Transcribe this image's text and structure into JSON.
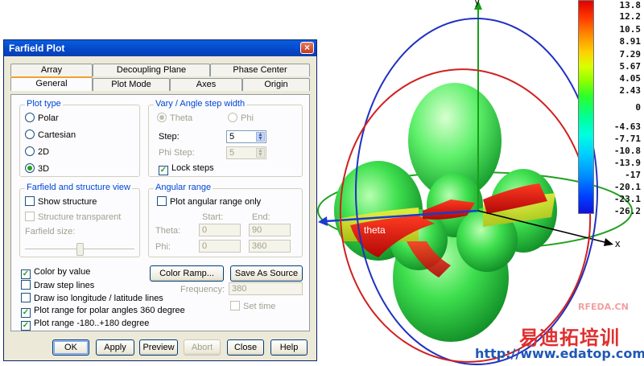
{
  "dialog": {
    "title": "Farfield Plot",
    "close_glyph": "×",
    "tabs_back": [
      "Array",
      "Decoupling Plane",
      "Phase Center"
    ],
    "tabs_front": [
      "General",
      "Plot Mode",
      "Axes",
      "Origin"
    ],
    "active_tab": "General",
    "plot_type": {
      "title": "Plot type",
      "options": [
        "Polar",
        "Cartesian",
        "2D",
        "3D"
      ],
      "selected": "3D"
    },
    "vary": {
      "title": "Vary / Angle step width",
      "theta_label": "Theta",
      "phi_label": "Phi",
      "step_label": "Step:",
      "step_value": "5",
      "phi_step_label": "Phi Step:",
      "phi_step_value": "5",
      "lock_steps_label": "Lock steps",
      "lock_steps_checked": true
    },
    "structure": {
      "title": "Farfield and structure view",
      "show_structure_label": "Show structure",
      "structure_transparent_label": "Structure transparent",
      "farfield_size_label": "Farfield size:",
      "farfield_size_level": 0.5
    },
    "angular": {
      "title": "Angular range",
      "plot_range_only_label": "Plot angular range only",
      "start_label": "Start:",
      "end_label": "End:",
      "theta_label": "Theta:",
      "theta_start": "0",
      "theta_end": "90",
      "phi_label": "Phi:",
      "phi_start": "0",
      "phi_end": "360"
    },
    "options": {
      "color_by_value": "Color by value",
      "draw_step_lines": "Draw step lines",
      "draw_iso": "Draw iso longitude / latitude lines",
      "plot_range_polar": "Plot range for polar angles 360 degree",
      "plot_range_180": "Plot range -180..+180 degree"
    },
    "color_ramp_button": "Color Ramp...",
    "save_as_source_button": "Save As Source",
    "frequency_label": "Frequency:",
    "frequency_value": "380",
    "set_time_label": "Set time",
    "buttons": {
      "ok": "OK",
      "apply": "Apply",
      "preview": "Preview",
      "abort": "Abort",
      "close": "Close",
      "help": "Help"
    }
  },
  "plot3d": {
    "axis_x": "x",
    "axis_y": "y",
    "theta_text": "theta",
    "colorbar_labels": [
      "13.8",
      "12.2",
      "10.5",
      "8.91",
      "7.29",
      "5.67",
      "4.05",
      "2.43",
      "0",
      "-4.63",
      "-7.71",
      "-10.8",
      "-13.9",
      "-17",
      "-20.1",
      "-23.1",
      "-26.2"
    ],
    "colors": {
      "green": "#2ed24a",
      "red": "#e81e1e",
      "yellow": "#e8e020",
      "ring_blue": "#2030c0",
      "ring_red": "#d02020",
      "ring_green": "#20a020"
    }
  },
  "watermark": {
    "cn": "易迪拓培训",
    "url": "http://www.edatop.com",
    "rfeda": "RFEDA.CN"
  }
}
